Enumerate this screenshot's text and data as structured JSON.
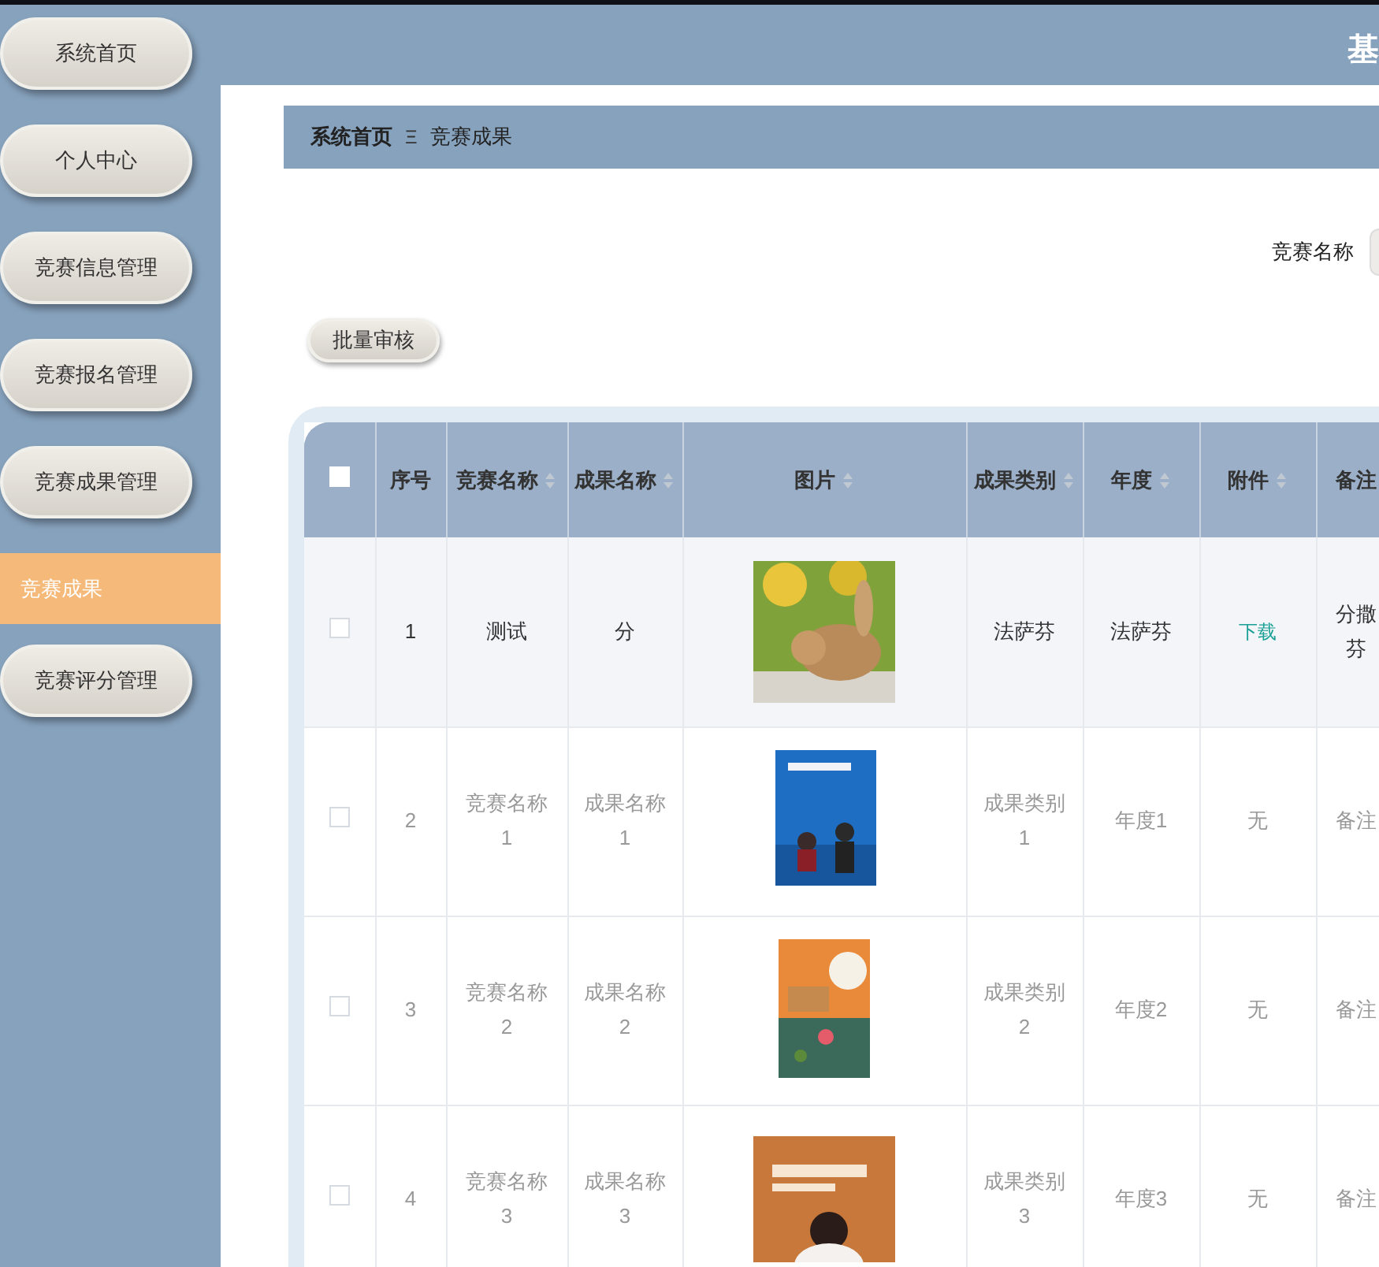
{
  "header": {
    "title": "基"
  },
  "sidebar": {
    "items": [
      {
        "label": "系统首页",
        "kind": "button",
        "selected": false
      },
      {
        "label": "个人中心",
        "kind": "button",
        "selected": false
      },
      {
        "label": "竞赛信息管理",
        "kind": "button",
        "selected": false
      },
      {
        "label": "竞赛报名管理",
        "kind": "button",
        "selected": false
      },
      {
        "label": "竞赛成果管理",
        "kind": "button",
        "selected": false
      },
      {
        "label": "竞赛成果",
        "kind": "sub",
        "selected": true
      },
      {
        "label": "竞赛评分管理",
        "kind": "button",
        "selected": false
      }
    ]
  },
  "breadcrumb": {
    "home": "系统首页",
    "separator": "Ξ",
    "current": "竞赛成果"
  },
  "search": {
    "label": "竞赛名称"
  },
  "actions": [
    "批量审核"
  ],
  "table": {
    "select_all": {
      "checked": false
    },
    "columns": [
      {
        "label": "序号",
        "sortable": false
      },
      {
        "label": "竞赛名称",
        "sortable": true
      },
      {
        "label": "成果名称",
        "sortable": true
      },
      {
        "label": "图片",
        "sortable": true
      },
      {
        "label": "成果类别",
        "sortable": true
      },
      {
        "label": "年度",
        "sortable": true
      },
      {
        "label": "附件",
        "sortable": true
      },
      {
        "label": "备注"
      }
    ],
    "rows": [
      {
        "checked": false,
        "hovered": true,
        "cells": [
          "1",
          "测试",
          "分",
          "",
          "法萨芬",
          "法萨芬",
          "下载",
          "分撒芬"
        ],
        "attachment_link": true
      },
      {
        "checked": false,
        "hovered": false,
        "cells": [
          "2",
          "竞赛名称\n1",
          "成果名称\n1",
          "",
          "成果类别\n1",
          "年度1",
          "无",
          "备注"
        ],
        "attachment_link": false
      },
      {
        "checked": false,
        "hovered": false,
        "cells": [
          "3",
          "竞赛名称\n2",
          "成果名称\n2",
          "",
          "成果类别\n2",
          "年度2",
          "无",
          "备注"
        ],
        "attachment_link": false
      },
      {
        "checked": false,
        "hovered": false,
        "cells": [
          "4",
          "竞赛名称\n3",
          "成果名称\n3",
          "",
          "成果类别\n3",
          "年度3",
          "无",
          "备注"
        ],
        "attachment_link": false
      }
    ]
  }
}
